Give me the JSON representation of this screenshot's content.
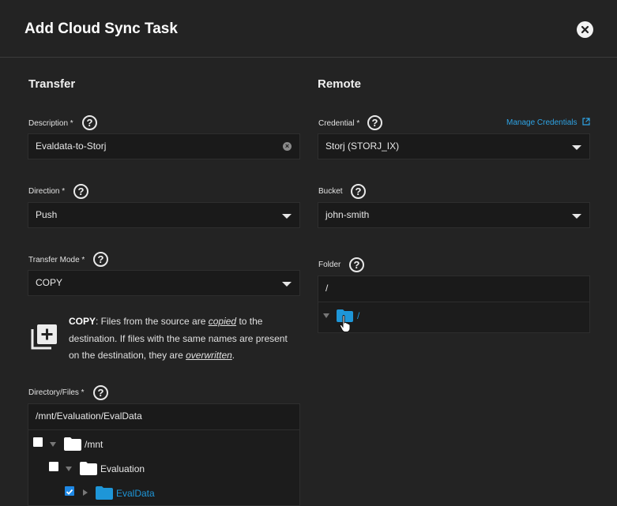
{
  "header": {
    "title": "Add Cloud Sync Task"
  },
  "transfer": {
    "title": "Transfer",
    "description": {
      "label": "Description *",
      "value": "Evaldata-to-Storj"
    },
    "direction": {
      "label": "Direction *",
      "value": "Push"
    },
    "transfer_mode": {
      "label": "Transfer Mode *",
      "value": "COPY"
    },
    "mode_help": {
      "keyword": "COPY",
      "t1": ": Files from the source are ",
      "em1": "copied",
      "t2": " to the destination. If files with the same names are present on the destination, they are ",
      "em2": "overwritten",
      "t3": "."
    },
    "directory": {
      "label": "Directory/Files *",
      "path": "/mnt/Evaluation/EvalData",
      "tree": [
        {
          "label": "/mnt",
          "checked": false
        },
        {
          "label": "Evaluation",
          "checked": false
        },
        {
          "label": "EvalData",
          "checked": true
        }
      ]
    }
  },
  "remote": {
    "title": "Remote",
    "credential": {
      "label": "Credential *",
      "value": "Storj (STORJ_IX)",
      "manage_link": "Manage Credentials"
    },
    "bucket": {
      "label": "Bucket",
      "value": "john-smith"
    },
    "folder": {
      "label": "Folder",
      "path": "/",
      "tree_node": "/"
    }
  },
  "icons": {
    "close": "close-icon",
    "help": "help-icon",
    "external": "external-link-icon",
    "mode": "library-add-icon",
    "folder": "folder-icon"
  },
  "colors": {
    "accent": "#1e96d8",
    "link": "#2ea3e4",
    "checkbox": "#1e88e5"
  }
}
